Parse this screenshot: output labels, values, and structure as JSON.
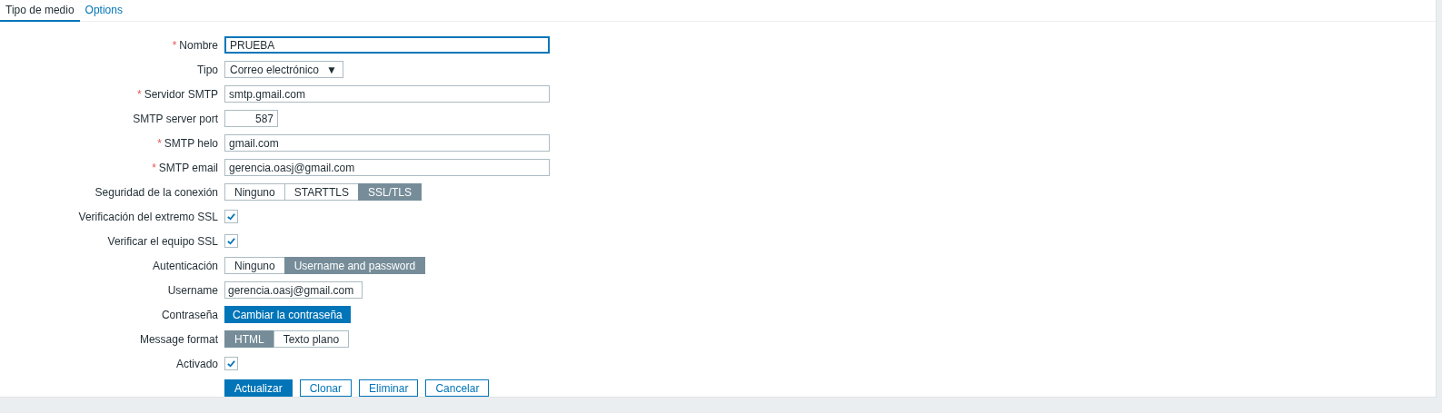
{
  "tabs": [
    {
      "label": "Tipo de medio",
      "selected": true
    },
    {
      "label": "Options",
      "selected": false
    }
  ],
  "form": {
    "rows": [
      {
        "kind": "text",
        "label": "Nombre",
        "required_mark": "*",
        "value": "PRUEBA",
        "focused": true
      },
      {
        "kind": "select",
        "label": "Tipo",
        "value": "Correo electrónico",
        "arrow": "▼"
      },
      {
        "kind": "text",
        "label": "Servidor SMTP",
        "required_mark": "*",
        "value": "smtp.gmail.com",
        "focused": false
      },
      {
        "kind": "number",
        "label": "SMTP server port",
        "value": "587"
      },
      {
        "kind": "text",
        "label": "SMTP helo",
        "required_mark": "*",
        "value": "gmail.com",
        "focused": false
      },
      {
        "kind": "text",
        "label": "SMTP email",
        "required_mark": "*",
        "value": "gerencia.oasj@gmail.com",
        "focused": false
      },
      {
        "kind": "segmented",
        "label": "Seguridad de la conexión",
        "options": [
          {
            "label": "Ninguno",
            "selected": false
          },
          {
            "label": "STARTTLS",
            "selected": false
          },
          {
            "label": "SSL/TLS",
            "selected": true
          }
        ]
      },
      {
        "kind": "checkbox",
        "label": "Verificación del extremo SSL",
        "checked": true
      },
      {
        "kind": "checkbox",
        "label": "Verificar el equipo SSL",
        "checked": true
      },
      {
        "kind": "segmented",
        "label": "Autenticación",
        "options": [
          {
            "label": "Ninguno",
            "selected": false
          },
          {
            "label": "Username and password",
            "selected": true
          }
        ]
      },
      {
        "kind": "short-text",
        "label": "Username",
        "value": "gerencia.oasj@gmail.com"
      },
      {
        "kind": "button",
        "label": "Contraseña",
        "button": "Cambiar la contraseña"
      },
      {
        "kind": "segmented",
        "label": "Message format",
        "options": [
          {
            "label": "HTML",
            "selected": true
          },
          {
            "label": "Texto plano",
            "selected": false
          }
        ]
      },
      {
        "kind": "checkbox",
        "label": "Activado",
        "checked": true
      }
    ],
    "buttons": [
      {
        "label": "Actualizar",
        "kind": "primary"
      },
      {
        "label": "Clonar",
        "kind": "secondary"
      },
      {
        "label": "Eliminar",
        "kind": "secondary"
      },
      {
        "label": "Cancelar",
        "kind": "secondary"
      }
    ]
  }
}
